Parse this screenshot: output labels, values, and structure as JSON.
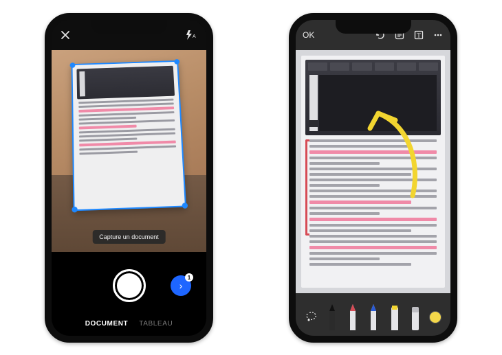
{
  "scanner": {
    "hint": "Capture un document",
    "badge_count": "1",
    "modes": {
      "document": "DOCUMENT",
      "tableau": "TABLEAU"
    }
  },
  "editor": {
    "ok_label": "OK",
    "tools": {
      "lasso": "lasso",
      "pen_black": "pen-black",
      "pen_red": "pen-red",
      "pen_blue": "pen-blue",
      "highlighter": "highlighter",
      "eraser": "eraser",
      "color": "#f4d84a"
    }
  }
}
